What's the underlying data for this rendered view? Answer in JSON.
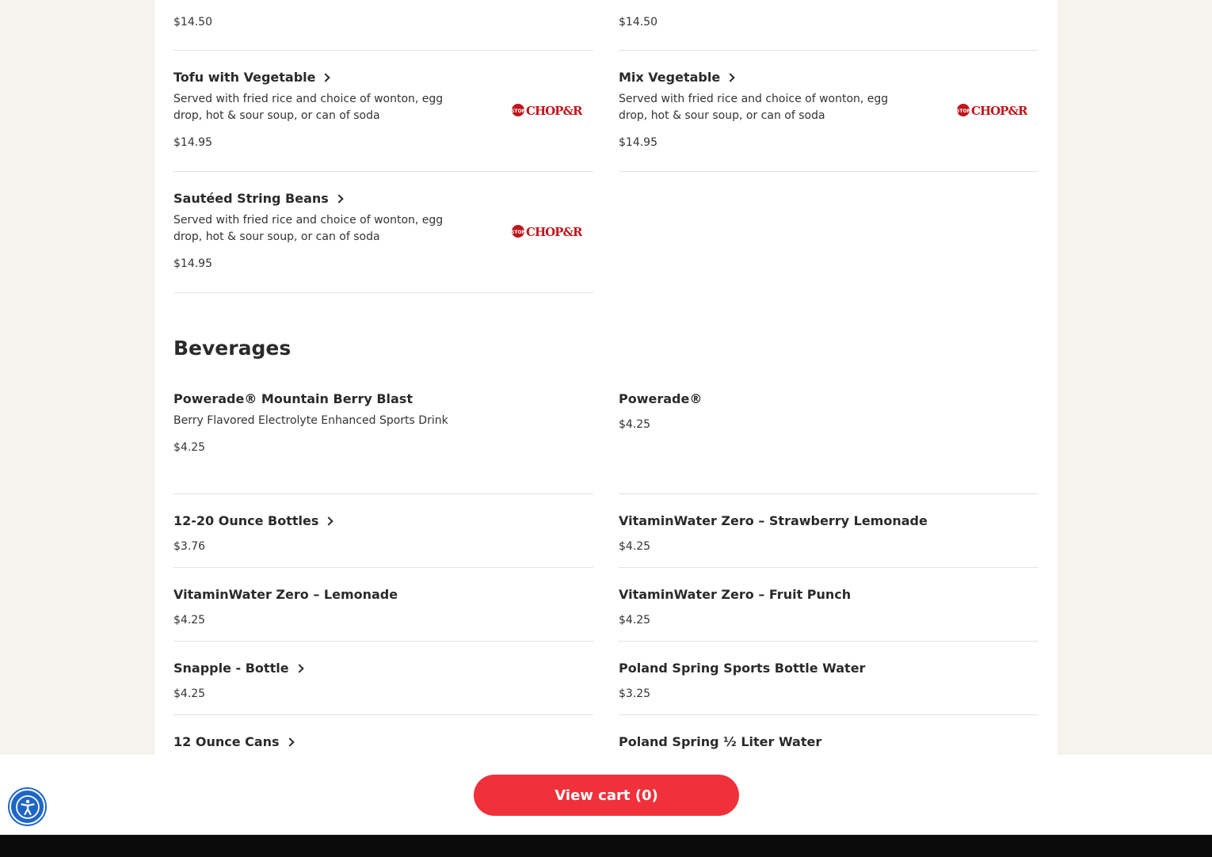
{
  "entrees": {
    "left": [
      {
        "name": "",
        "price": "$14.50"
      },
      {
        "name": "Tofu with Vegetable",
        "desc": "Served with fried rice and choice of wonton, egg drop, hot & sour soup, or can of soda",
        "price": "$14.95"
      },
      {
        "name": "Sautéed String Beans",
        "desc": "Served with fried rice and choice of wonton, egg drop, hot & sour soup, or can of soda",
        "price": "$14.95"
      }
    ],
    "right": [
      {
        "name": "",
        "price": "$14.50"
      },
      {
        "name": "Mix Vegetable",
        "desc": "Served with fried rice and choice of wonton, egg drop, hot & sour soup, or can of soda",
        "price": "$14.95"
      }
    ]
  },
  "beverages": {
    "title": "Beverages",
    "left": [
      {
        "name": "Powerade® Mountain Berry Blast",
        "desc": "Berry Flavored Electrolyte Enhanced Sports Drink",
        "price": "$4.25"
      },
      {
        "name": "12-20 Ounce Bottles",
        "price": "$3.76"
      },
      {
        "name": "VitaminWater Zero – Lemonade",
        "price": "$4.25"
      },
      {
        "name": "Snapple - Bottle",
        "price": "$4.25"
      },
      {
        "name": "12 Ounce Cans",
        "price": ""
      }
    ],
    "right": [
      {
        "name": "Powerade®",
        "price": "$4.25"
      },
      {
        "name": "VitaminWater Zero – Strawberry Lemonade",
        "price": "$4.25"
      },
      {
        "name": "VitaminWater Zero – Fruit Punch",
        "price": "$4.25"
      },
      {
        "name": "Poland Spring Sports Bottle Water",
        "price": "$3.25"
      },
      {
        "name": "Poland Spring ½ Liter Water",
        "price": ""
      }
    ]
  },
  "cart": {
    "label": "View cart (0)"
  },
  "icons": {
    "item_logo": "stop-chop-roll-logo-icon",
    "accessibility": "accessibility-icon",
    "chevron": "chevron-right-icon"
  },
  "colors": {
    "accent": "#f0313b",
    "a11y": "#1e66c6"
  }
}
